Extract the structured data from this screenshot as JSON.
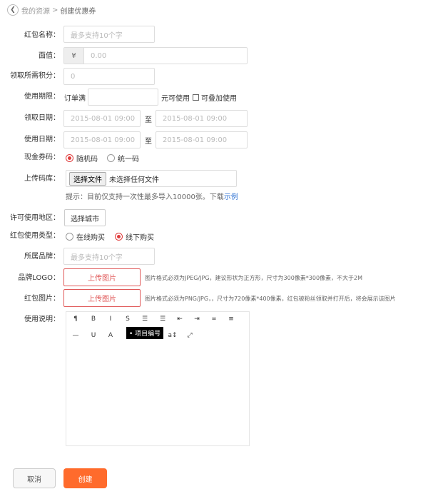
{
  "breadcrumb": {
    "back_icon": "chevron-left-icon",
    "parent": "我的资源",
    "separator": ">",
    "current": "创建优惠券"
  },
  "form": {
    "name": {
      "label": "红包名称：",
      "placeholder": "最多支持10个字"
    },
    "face_value": {
      "label": "面值：",
      "currency": "¥",
      "placeholder": "0.00"
    },
    "points": {
      "label": "领取所需积分：",
      "value": "0"
    },
    "validity": {
      "label": "使用期限：",
      "prefix": "订单满",
      "value": "",
      "suffix": "元可使用",
      "stack_label": "可叠加使用"
    },
    "receive_date": {
      "label": "领取日期：",
      "start": "2015-08-01 09:00",
      "to": "至",
      "end": "2015-08-01 09:00"
    },
    "use_date": {
      "label": "使用日期：",
      "start": "2015-08-01 09:00",
      "to": "至",
      "end": "2015-08-01 09:00"
    },
    "code_type": {
      "label": "现金券码：",
      "options": [
        "随机码",
        "统一码"
      ],
      "selected": "随机码"
    },
    "upload_lib": {
      "label": "上传码库：",
      "choose_button": "选择文件",
      "no_file": "未选择任何文件",
      "hint": "提示：目前仅支持一次性最多导入10000张。下载",
      "hint_link": "示例"
    },
    "region": {
      "label": "许可使用地区：",
      "button": "选择城市"
    },
    "purchase_type": {
      "label": "红包使用类型：",
      "options": [
        "在线购买",
        "线下购买"
      ],
      "selected": "线下购买"
    },
    "brand": {
      "label": "所属品牌：",
      "placeholder": "最多支持10个字"
    },
    "brand_logo": {
      "label": "品牌LOGO：",
      "button": "上传图片",
      "hint": "图片格式必须为JPEG/JPG，建议形状为正方形，尺寸为300像素*300像素，不大于2M"
    },
    "coupon_image": {
      "label": "红包图片：",
      "button": "上传图片",
      "hint": "图片格式必须为PNG/JPG，，尺寸为720像素*400像素，红包被粉丝领取并打开后，将会展示该图片"
    },
    "description": {
      "label": "使用说明：",
      "tooltip": "• 项目编号"
    }
  },
  "editor_toolbar": {
    "row1": [
      {
        "name": "paragraph-icon",
        "glyph": "¶"
      },
      {
        "name": "bold-icon",
        "glyph": "B"
      },
      {
        "name": "italic-icon",
        "glyph": "I"
      },
      {
        "name": "strikethrough-icon",
        "glyph": "S"
      },
      {
        "name": "bulleted-list-icon",
        "glyph": "☰"
      },
      {
        "name": "numbered-list-icon",
        "glyph": "☰"
      },
      {
        "name": "outdent-icon",
        "glyph": "⇤"
      },
      {
        "name": "indent-icon",
        "glyph": "⇥"
      },
      {
        "name": "link-icon",
        "glyph": "∞"
      },
      {
        "name": "align-left-icon",
        "glyph": "≡"
      }
    ],
    "row2": [
      {
        "name": "horizontal-rule-icon",
        "glyph": "—"
      },
      {
        "name": "underline-icon",
        "glyph": "U"
      },
      {
        "name": "font-color-icon",
        "glyph": "A"
      },
      {
        "name": "font-size-icon",
        "glyph": "a↕"
      },
      {
        "name": "fullscreen-icon",
        "glyph": "⤢"
      }
    ]
  },
  "actions": {
    "cancel": "取消",
    "create": "创建"
  },
  "colors": {
    "accent": "#ff6b2c",
    "radio_active": "#e03c3c",
    "upload_border": "#e05a5a",
    "link": "#3b7bd6"
  }
}
